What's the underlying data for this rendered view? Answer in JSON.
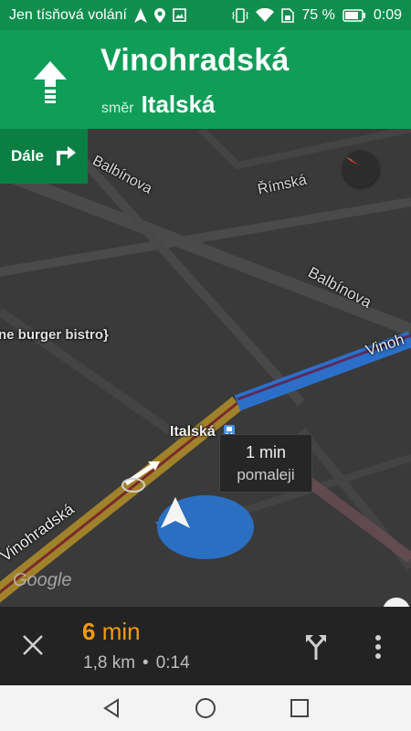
{
  "status_bar": {
    "carrier_text": "Jen tísňová volání",
    "battery_percent": "75 %",
    "time": "0:09",
    "icons": [
      "navigation-arrow-icon",
      "location-pin-icon",
      "image-icon",
      "vibrate-icon",
      "wifi-icon",
      "sim-icon",
      "battery-icon"
    ]
  },
  "navigation": {
    "maneuver_icon": "straight-arrow-icon",
    "street": "Vinohradská",
    "direction_prefix": "směr",
    "direction_street": "Italská",
    "next_label": "Dále",
    "next_icon": "turn-right-arrow-icon"
  },
  "map": {
    "labels": {
      "balbinova_top": "Balbínova",
      "rimska": "Římská",
      "balbinova_right": "Balbínova",
      "burger": "ne burger bistro}",
      "vinohradska_right": "Vinoh",
      "italska": "Italská",
      "vinohradska_left": "Vinohradská",
      "google": "Google"
    },
    "traffic": {
      "line1": "1 min",
      "line2": "pomaleji"
    }
  },
  "trip": {
    "eta_number": "6",
    "eta_unit": "min",
    "distance": "1,8 km",
    "separator": "•",
    "arrival": "0:14"
  },
  "colors": {
    "header_green": "#0f9d58",
    "route_blue": "#2b6fc8",
    "traffic_slow": "#b8902f",
    "eta_orange": "#f29b11",
    "map_bg": "#3a3a3a"
  }
}
